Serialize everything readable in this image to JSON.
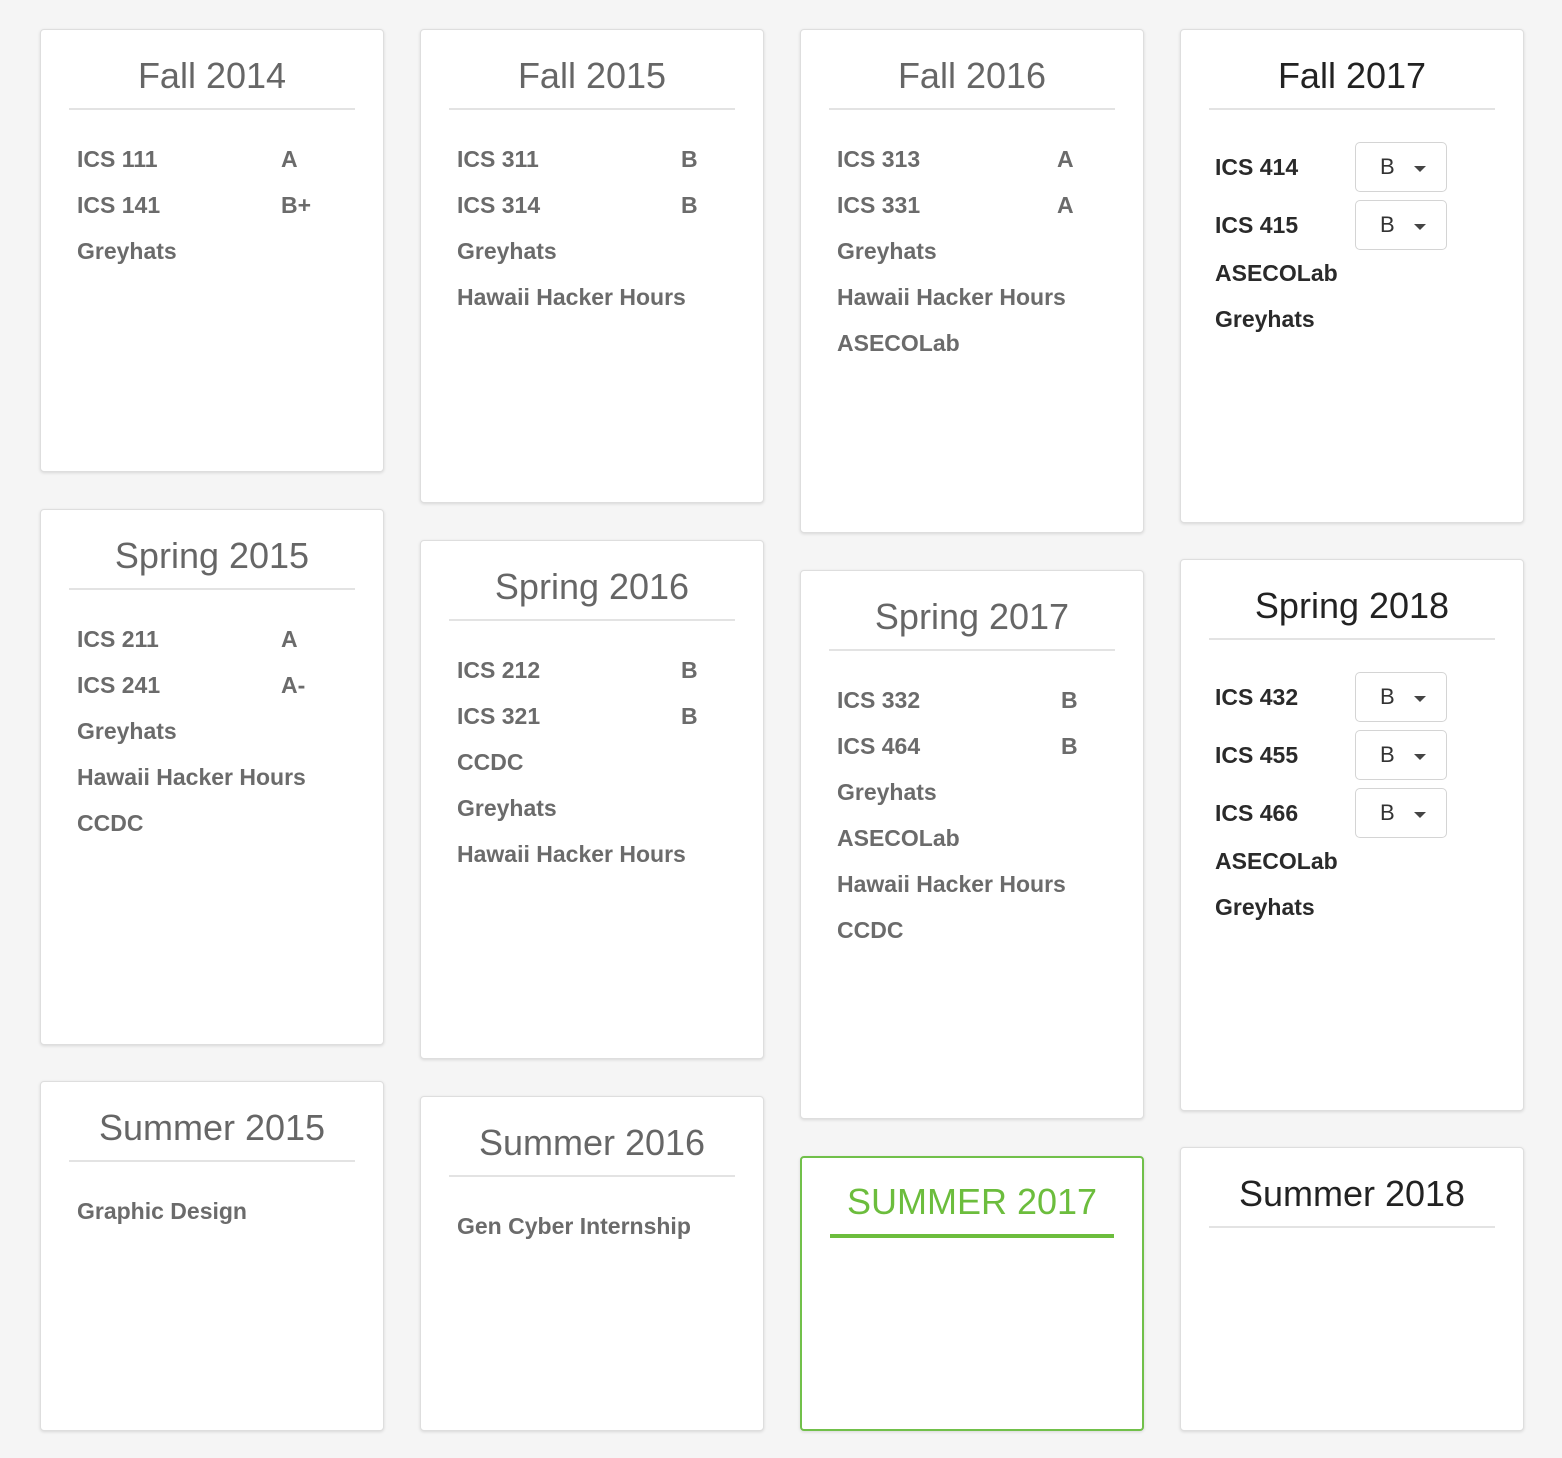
{
  "semesters": [
    {
      "title": "Fall 2014",
      "items": [
        {
          "name": "ICS 111",
          "grade": "A"
        },
        {
          "name": "ICS 141",
          "grade": "B+"
        },
        {
          "name": "Greyhats"
        }
      ]
    },
    {
      "title": "Fall 2015",
      "items": [
        {
          "name": "ICS 311",
          "grade": "B"
        },
        {
          "name": "ICS 314",
          "grade": "B"
        },
        {
          "name": "Greyhats"
        },
        {
          "name": "Hawaii Hacker Hours"
        }
      ]
    },
    {
      "title": "Fall 2016",
      "items": [
        {
          "name": "ICS 313",
          "grade": "A"
        },
        {
          "name": "ICS 331",
          "grade": "A"
        },
        {
          "name": "Greyhats"
        },
        {
          "name": "Hawaii Hacker Hours"
        },
        {
          "name": "ASECOLab"
        }
      ]
    },
    {
      "title": "Fall 2017",
      "items": [
        {
          "name": "ICS 414",
          "grade": "B"
        },
        {
          "name": "ICS 415",
          "grade": "B"
        },
        {
          "name": "ASECOLab"
        },
        {
          "name": "Greyhats"
        }
      ]
    },
    {
      "title": "Spring 2015",
      "items": [
        {
          "name": "ICS 211",
          "grade": "A"
        },
        {
          "name": "ICS 241",
          "grade": "A-"
        },
        {
          "name": "Greyhats"
        },
        {
          "name": "Hawaii Hacker Hours"
        },
        {
          "name": "CCDC"
        }
      ]
    },
    {
      "title": "Spring 2016",
      "items": [
        {
          "name": "ICS 212",
          "grade": "B"
        },
        {
          "name": "ICS 321",
          "grade": "B"
        },
        {
          "name": "CCDC"
        },
        {
          "name": "Greyhats"
        },
        {
          "name": "Hawaii Hacker Hours"
        }
      ]
    },
    {
      "title": "Spring 2017",
      "items": [
        {
          "name": "ICS 332",
          "grade": "B"
        },
        {
          "name": "ICS 464",
          "grade": "B"
        },
        {
          "name": "Greyhats"
        },
        {
          "name": "ASECOLab"
        },
        {
          "name": "Hawaii Hacker Hours"
        },
        {
          "name": "CCDC"
        }
      ]
    },
    {
      "title": "Spring 2018",
      "items": [
        {
          "name": "ICS 432",
          "grade": "B"
        },
        {
          "name": "ICS 455",
          "grade": "B"
        },
        {
          "name": "ICS 466",
          "grade": "B"
        },
        {
          "name": "ASECOLab"
        },
        {
          "name": "Greyhats"
        }
      ]
    },
    {
      "title": "Summer 2015",
      "items": [
        {
          "name": "Graphic Design"
        }
      ]
    },
    {
      "title": "Summer 2016",
      "items": [
        {
          "name": "Gen Cyber Internship"
        }
      ]
    },
    {
      "title": "Summer 2017",
      "items": []
    },
    {
      "title": "Summer 2018",
      "items": []
    }
  ],
  "colors": {
    "highlight": "#6cbd3d",
    "background": "#f5f5f5"
  }
}
